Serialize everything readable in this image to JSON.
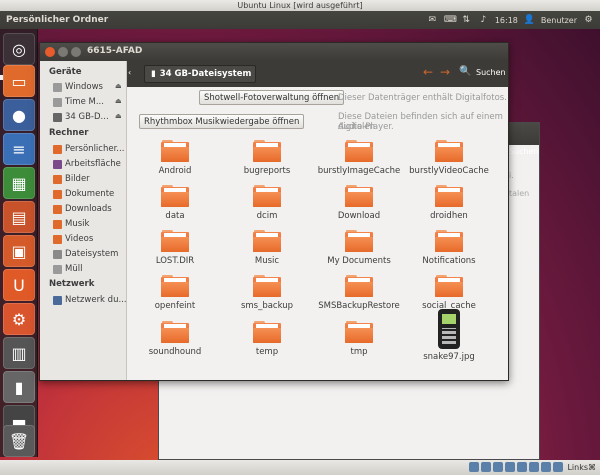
{
  "vbox_title": "Ubuntu Linux [wird ausgeführt]",
  "panel": {
    "app_title": "Persönlicher Ordner",
    "clock": "16:18",
    "user": "Benutzer"
  },
  "window": {
    "title": "6615-AFAD",
    "path_button": "34 GB-Dateisystem",
    "search_label": "Suchen"
  },
  "sidebar": {
    "sections": [
      {
        "heading": "Geräte"
      },
      {
        "heading": "Rechner"
      },
      {
        "heading": "Netzwerk"
      }
    ],
    "devices": [
      "Windows",
      "Time M...",
      "34 GB-D..."
    ],
    "computer": [
      "Persönlicher...",
      "Arbeitsfläche",
      "Bilder",
      "Dokumente",
      "Downloads",
      "Musik",
      "Videos",
      "Dateisystem",
      "Müll"
    ],
    "network": [
      "Netzwerk du..."
    ]
  },
  "infobars": [
    {
      "button": "Shotwell-Fotoverwaltung öffnen",
      "text": "Dieser Datenträger enthält Digitalfotos."
    },
    {
      "button": "Rhythmbox Musikwiedergabe öffnen",
      "text_line1": "Diese Dateien befinden sich auf einem digitalen",
      "text_line2": "Audio-Player."
    }
  ],
  "items": [
    "Android",
    "bugreports",
    "burstlyImageCache",
    "burstlyVideoCache",
    "data",
    "dcim",
    "Download",
    "droidhen",
    "LOST.DIR",
    "Music",
    "My Documents",
    "Notifications",
    "openfeint",
    "sms_backup",
    "SMSBackupRestore",
    "social_cache",
    "soundhound",
    "temp",
    "tmp",
    "snake97.jpg"
  ],
  "background_window": {
    "search_label": "Suchen",
    "text1": "i.",
    "text2": "talen"
  },
  "taskbar": {
    "host_key": "Links⌘"
  }
}
